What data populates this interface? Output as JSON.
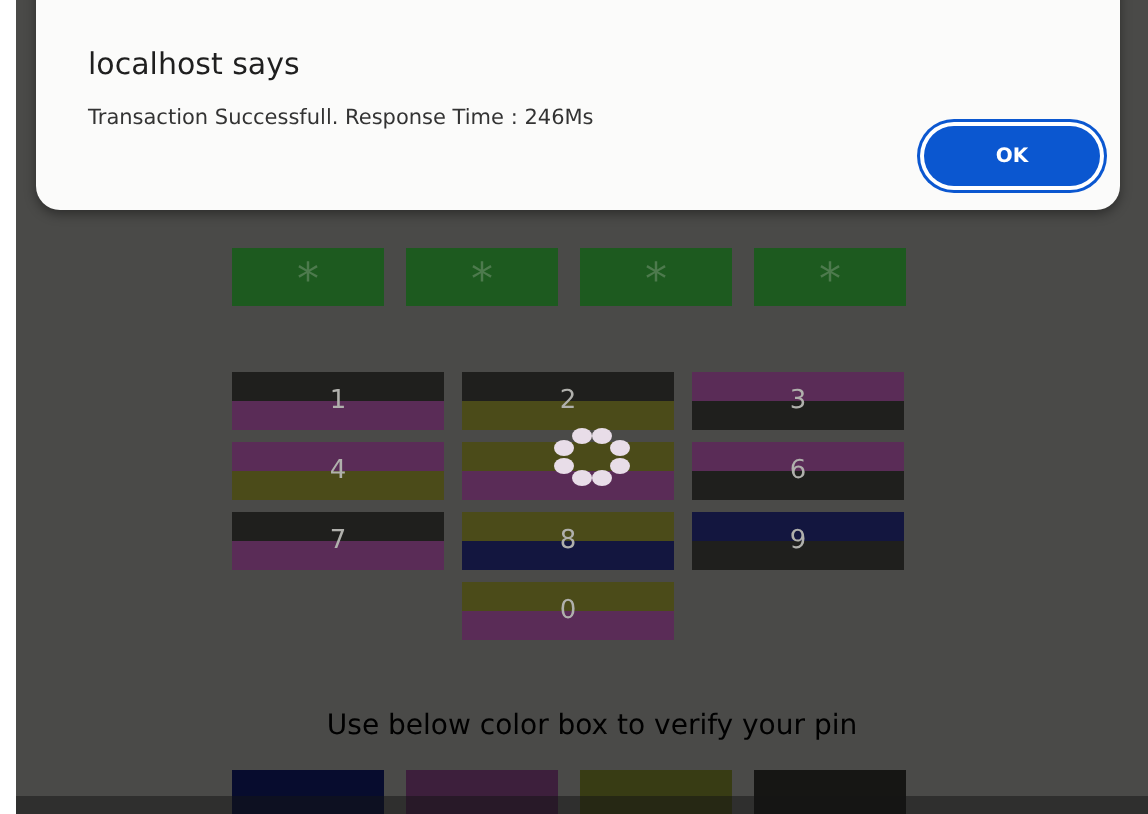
{
  "dialog": {
    "title": "localhost says",
    "message": "Transaction Successfull. Response Time : 246Ms",
    "button": "OK"
  },
  "pin_boxes": [
    "*",
    "*",
    "*",
    "*"
  ],
  "keypad": [
    {
      "label": "1",
      "stripes": [
        {
          "color": "#1f1f1d"
        },
        {
          "color": "#5a2c57"
        }
      ]
    },
    {
      "label": "2",
      "stripes": [
        {
          "color": "#1f1f1d"
        },
        {
          "color": "#4b4b19"
        }
      ]
    },
    {
      "label": "3",
      "stripes": [
        {
          "color": "#5a2c57"
        },
        {
          "color": "#1f1f1d"
        }
      ]
    },
    {
      "label": "4",
      "stripes": [
        {
          "color": "#5a2c57"
        },
        {
          "color": "#4b4b19"
        }
      ]
    },
    {
      "stripes": [
        {
          "color": "#4b4b19"
        },
        {
          "color": "#5a2c57"
        }
      ]
    },
    {
      "label": "6",
      "stripes": [
        {
          "color": "#5a2c57"
        },
        {
          "color": "#1f1f1d"
        }
      ]
    },
    {
      "label": "7",
      "stripes": [
        {
          "color": "#1f1f1d"
        },
        {
          "color": "#5a2c57"
        }
      ]
    },
    {
      "label": "8",
      "stripes": [
        {
          "color": "#4b4b19"
        },
        {
          "color": "#13163f"
        }
      ]
    },
    {
      "label": "9",
      "stripes": [
        {
          "color": "#13163f"
        },
        {
          "color": "#1f1f1d"
        }
      ]
    },
    {
      "label": "0",
      "stripes": [
        {
          "color": "#4b4b19"
        },
        {
          "color": "#5a2c57"
        }
      ]
    }
  ],
  "hint": "Use below color box to verify your pin",
  "verify_boxes": [
    {
      "color": "#070c2e"
    },
    {
      "color": "#3d1f3c"
    },
    {
      "color": "#383c14"
    },
    {
      "color": "#161614"
    }
  ]
}
